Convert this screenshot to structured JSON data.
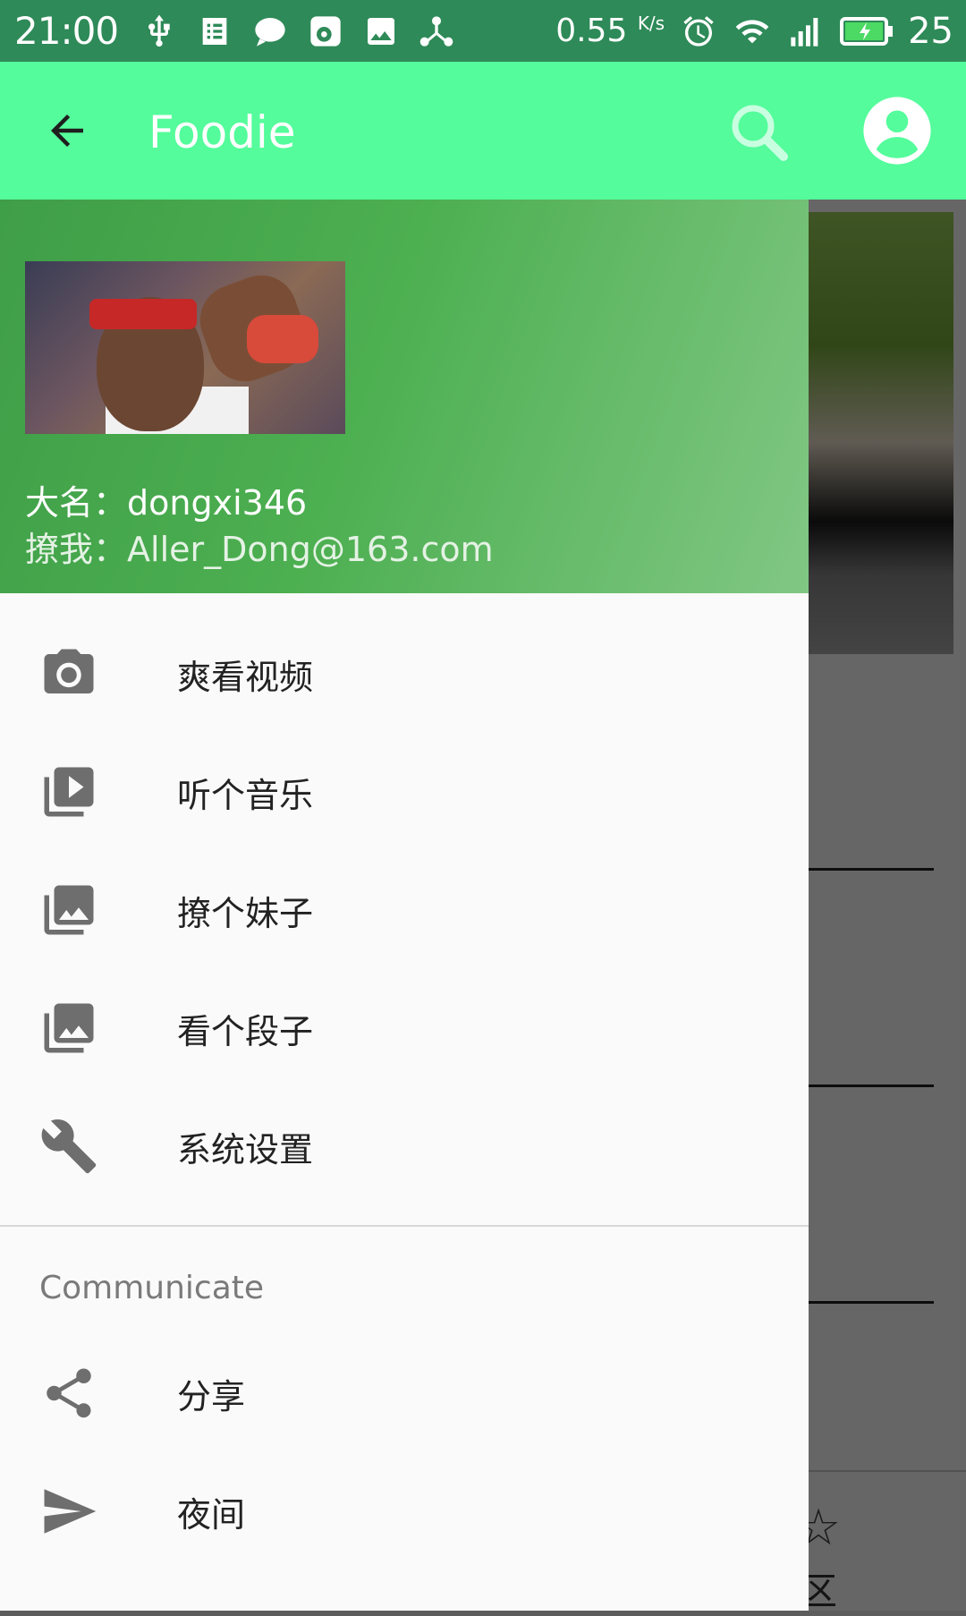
{
  "status_bar": {
    "time": "21:00",
    "speed_value": "0.55",
    "speed_unit": "K/s",
    "battery_level": "25",
    "left_icons": [
      "usb-icon",
      "notes-icon",
      "chat-icon",
      "weibo-icon",
      "image-icon",
      "share-network-icon"
    ],
    "right_icons": [
      "alarm-icon",
      "wifi-icon",
      "signal-icon",
      "battery-charging-icon"
    ]
  },
  "app_bar": {
    "title": "Foodie",
    "back_icon": "arrow-back-icon",
    "search_icon": "search-icon",
    "account_icon": "account-circle-icon",
    "color": "#54fc9b"
  },
  "drawer": {
    "header": {
      "name_label": "大名：",
      "name_value": "dongxi346",
      "email_label": "撩我：",
      "email_value": "Aller_Dong@163.com"
    },
    "items": [
      {
        "label": "爽看视频",
        "icon": "camera-icon"
      },
      {
        "label": "听个音乐",
        "icon": "video-library-icon"
      },
      {
        "label": "撩个妹子",
        "icon": "photo-library-icon"
      },
      {
        "label": "看个段子",
        "icon": "photo-library-icon"
      },
      {
        "label": "系统设置",
        "icon": "wrench-icon"
      }
    ],
    "section_title": "Communicate",
    "section_items": [
      {
        "label": "分享",
        "icon": "share-icon"
      },
      {
        "label": "夜间",
        "icon": "send-icon"
      }
    ]
  },
  "background": {
    "bottom_nav_partial_label": "区"
  },
  "colors": {
    "status_bar": "#2e8a58",
    "header_gradient_start": "#3f9e48",
    "header_gradient_end": "#81c784",
    "icon_gray": "#6e6e6e"
  }
}
